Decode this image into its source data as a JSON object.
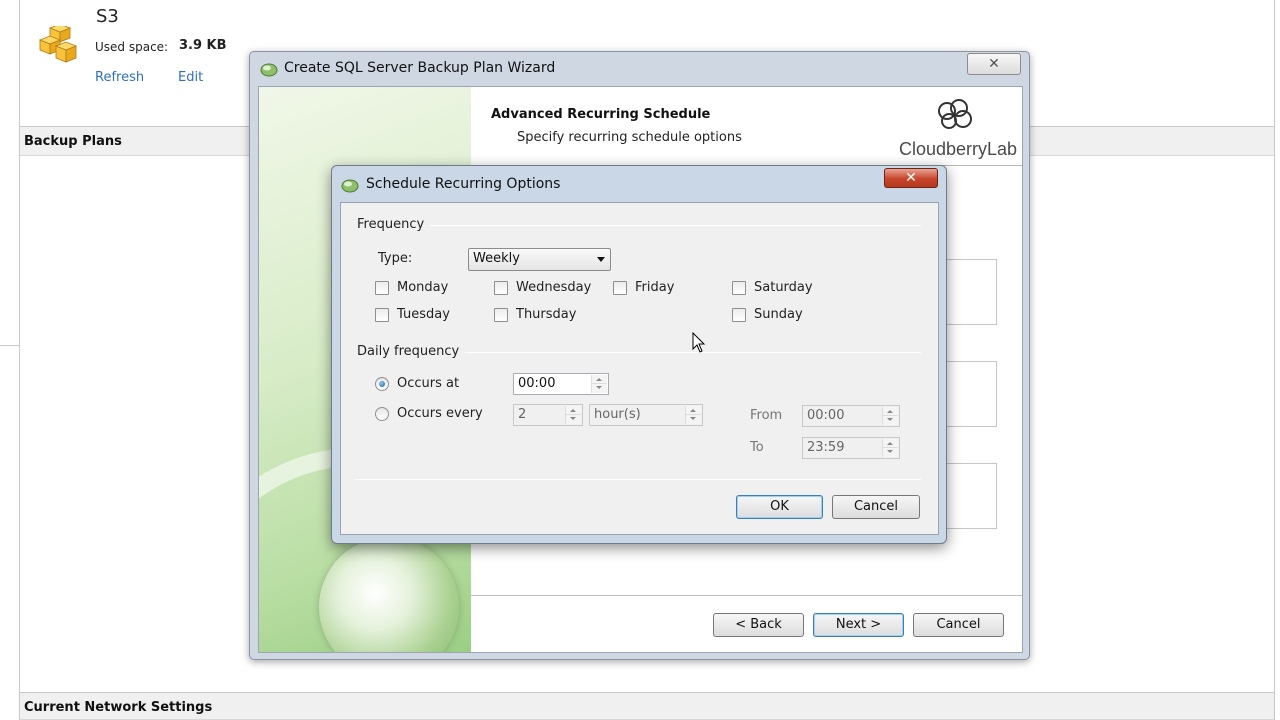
{
  "storage": {
    "title": "S3",
    "used_label": "Used space:",
    "used_value": "3.9 KB",
    "refresh_link": "Refresh",
    "edit_link": "Edit"
  },
  "sections": {
    "backup_plans": "Backup Plans",
    "network_settings": "Current Network Settings"
  },
  "wizard": {
    "title": "Create SQL Server Backup Plan Wizard",
    "close_glyph": "✕",
    "header_title": "Advanced Recurring Schedule",
    "header_subtitle": "Specify recurring schedule options",
    "logo_text": "CloudberryLab",
    "back_button": "< Back",
    "next_button": "Next >",
    "cancel_button": "Cancel"
  },
  "dialog": {
    "title": "Schedule Recurring Options",
    "close_glyph": "✕",
    "frequency_group": "Frequency",
    "type_label": "Type:",
    "type_value": "Weekly",
    "days": {
      "monday": "Monday",
      "tuesday": "Tuesday",
      "wednesday": "Wednesday",
      "thursday": "Thursday",
      "friday": "Friday",
      "saturday": "Saturday",
      "sunday": "Sunday"
    },
    "daily_group": "Daily frequency",
    "occurs_at_label": "Occurs at",
    "occurs_at_value": "00:00",
    "occurs_every_label": "Occurs every",
    "occurs_every_value": "2",
    "occurs_every_unit": "hour(s)",
    "from_label": "From",
    "from_value": "00:00",
    "to_label": "To",
    "to_value": "23:59",
    "ok_button": "OK",
    "cancel_button": "Cancel"
  },
  "colors": {
    "link": "#2f6fc0",
    "dialog_close": "#c6452a",
    "wizard_side_green": "#b8dda2"
  }
}
